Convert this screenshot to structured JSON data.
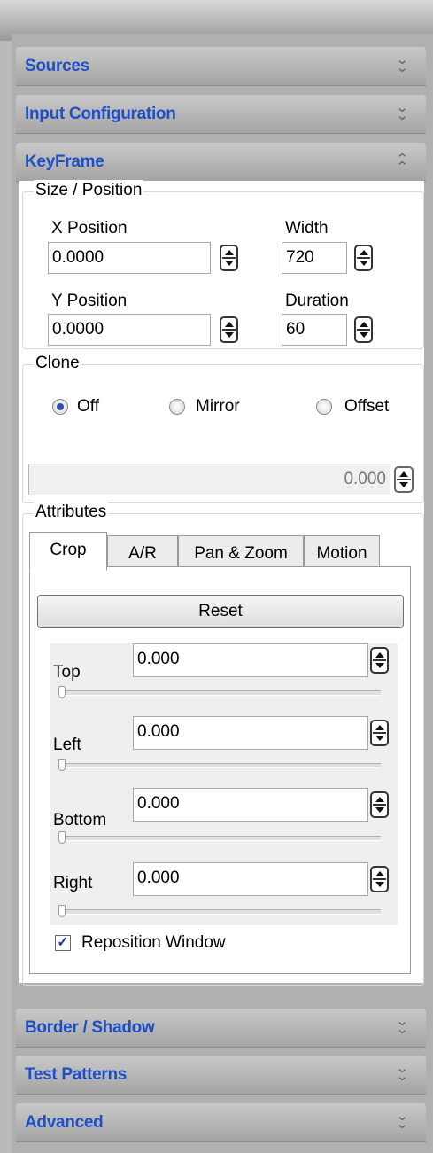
{
  "panels": {
    "sources": "Sources",
    "input_configuration": "Input Configuration",
    "keyframe": "KeyFrame",
    "border_shadow": "Border / Shadow",
    "test_patterns": "Test Patterns",
    "advanced": "Advanced"
  },
  "chevrons": {
    "collapsed": "⌄⌄",
    "expanded": "⌃⌃"
  },
  "size_position": {
    "legend": "Size / Position",
    "x_label": "X Position",
    "x_value": "0.0000",
    "width_label": "Width",
    "width_value": "720",
    "y_label": "Y Position",
    "y_value": "0.0000",
    "duration_label": "Duration",
    "duration_value": "60"
  },
  "clone": {
    "legend": "Clone",
    "options": [
      "Off",
      "Mirror",
      "Offset"
    ],
    "selected": "Off",
    "value": "0.000"
  },
  "attributes": {
    "legend": "Attributes",
    "tabs": [
      "Crop",
      "A/R",
      "Pan & Zoom",
      "Motion"
    ],
    "active_tab": "Crop",
    "reset_label": "Reset",
    "crop": [
      {
        "label": "Top",
        "value": "0.000",
        "slider": 0
      },
      {
        "label": "Left",
        "value": "0.000",
        "slider": 0
      },
      {
        "label": "Bottom",
        "value": "0.000",
        "slider": 0
      },
      {
        "label": "Right",
        "value": "0.000",
        "slider": 0
      }
    ],
    "reposition_label": "Reposition Window",
    "reposition_checked": true
  },
  "colors": {
    "header_text": "#1f4fc8",
    "radio_selected": "#2a4fa5"
  }
}
